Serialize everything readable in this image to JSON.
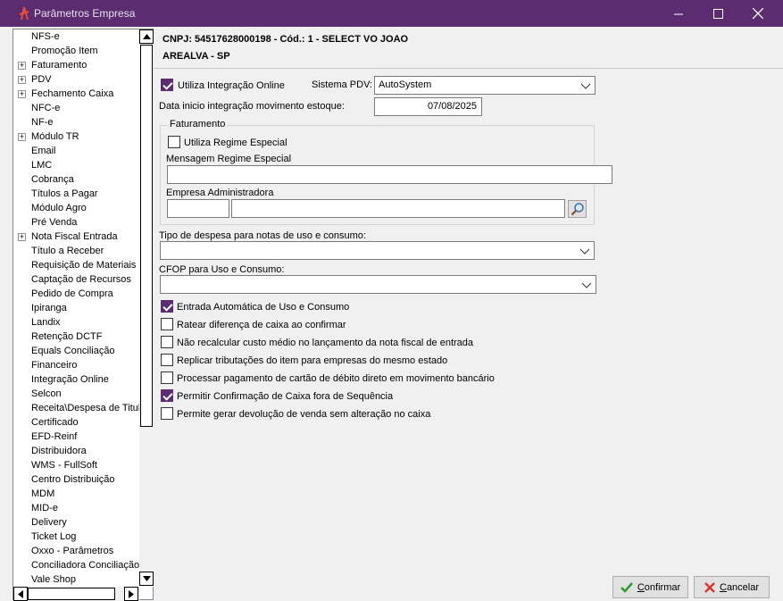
{
  "window": {
    "title": "Parâmetros Empresa",
    "minimize": "—",
    "maximize": "☐",
    "close": "✕"
  },
  "sidebar": {
    "items": [
      {
        "label": "NFS-e",
        "expandable": false
      },
      {
        "label": "Promoção Item",
        "expandable": false
      },
      {
        "label": "Faturamento",
        "expandable": true
      },
      {
        "label": "PDV",
        "expandable": true
      },
      {
        "label": "Fechamento Caixa",
        "expandable": true
      },
      {
        "label": "NFC-e",
        "expandable": false
      },
      {
        "label": "NF-e",
        "expandable": false
      },
      {
        "label": "Módulo TR",
        "expandable": true
      },
      {
        "label": "Email",
        "expandable": false
      },
      {
        "label": "LMC",
        "expandable": false
      },
      {
        "label": "Cobrança",
        "expandable": false
      },
      {
        "label": "Títulos a Pagar",
        "expandable": false
      },
      {
        "label": "Módulo Agro",
        "expandable": false
      },
      {
        "label": "Pré Venda",
        "expandable": false
      },
      {
        "label": "Nota Fiscal Entrada",
        "expandable": true
      },
      {
        "label": "Título a Receber",
        "expandable": false
      },
      {
        "label": "Requisição de Materiais",
        "expandable": false
      },
      {
        "label": "Captação de Recursos",
        "expandable": false
      },
      {
        "label": "Pedido de Compra",
        "expandable": false
      },
      {
        "label": "Ipiranga",
        "expandable": false
      },
      {
        "label": "Landix",
        "expandable": false
      },
      {
        "label": "Retenção DCTF",
        "expandable": false
      },
      {
        "label": "Equals Conciliação",
        "expandable": false
      },
      {
        "label": "Financeiro",
        "expandable": false
      },
      {
        "label": "Integração Online",
        "expandable": false
      },
      {
        "label": "Selcon",
        "expandable": false
      },
      {
        "label": "Receita\\Despesa de Titul",
        "expandable": false
      },
      {
        "label": "Certificado",
        "expandable": false
      },
      {
        "label": "EFD-Reinf",
        "expandable": false
      },
      {
        "label": "Distribuidora",
        "expandable": false
      },
      {
        "label": "WMS - FullSoft",
        "expandable": false
      },
      {
        "label": "Centro Distribuição",
        "expandable": false
      },
      {
        "label": "MDM",
        "expandable": false
      },
      {
        "label": "MID-e",
        "expandable": false
      },
      {
        "label": "Delivery",
        "expandable": false
      },
      {
        "label": "Ticket Log",
        "expandable": false
      },
      {
        "label": "Oxxo - Parâmetros",
        "expandable": false
      },
      {
        "label": "Conciliadora Conciliação",
        "expandable": false
      },
      {
        "label": "Vale Shop",
        "expandable": false
      }
    ],
    "expand_glyph": "+",
    "scroll_up": "▲",
    "scroll_down": "▼",
    "scroll_left": "◀",
    "scroll_right": "▶"
  },
  "header": {
    "line1": "CNPJ: 54517628000198 - Cód.: 1 - SELECT VO JOAO",
    "line2": "AREALVA - SP"
  },
  "form": {
    "integracao_online": {
      "label": "Utiliza Integração Online",
      "checked": true
    },
    "sistema_pdv": {
      "label": "Sistema PDV:",
      "value": "AutoSystem"
    },
    "data_inicio": {
      "label": "Data inicio integração movimento estoque:",
      "value": "07/08/2025"
    },
    "faturamento": {
      "title": "Faturamento",
      "regime_especial": {
        "label": "Utiliza Regime Especial",
        "checked": false
      },
      "mensagem_label": "Mensagem Regime Especial",
      "mensagem_value": "",
      "empresa_label": "Empresa Administradora",
      "empresa_code": "",
      "empresa_name": ""
    },
    "tipo_despesa": {
      "label": "Tipo de despesa para notas de uso e consumo:",
      "value": ""
    },
    "cfop": {
      "label": "CFOP para Uso e Consumo:",
      "value": ""
    },
    "options": [
      {
        "label": "Entrada Automática de Uso e Consumo",
        "checked": true
      },
      {
        "label": "Ratear diferença de caixa ao confirmar",
        "checked": false
      },
      {
        "label": "Não recalcular custo médio no lançamento da nota fiscal de entrada",
        "checked": false
      },
      {
        "label": "Replicar tributações do item para empresas do mesmo estado",
        "checked": false
      },
      {
        "label": "Processar pagamento de cartão de débito direto em movimento bancário",
        "checked": false
      },
      {
        "label": "Permitir Confirmação de Caixa fora de Sequência",
        "checked": true
      },
      {
        "label": "Permite gerar devolução de venda sem alteração no caixa",
        "checked": false
      }
    ]
  },
  "footer": {
    "confirm_label_u": "C",
    "confirm_label_rest": "onfirmar",
    "cancel_label_u": "C",
    "cancel_label_rest": "ancelar"
  },
  "colors": {
    "titlebar": "#5b2c6f",
    "checkbox_checked": "#5b2c6f",
    "confirm_icon": "#2e9b2e",
    "cancel_icon": "#d9302c"
  }
}
